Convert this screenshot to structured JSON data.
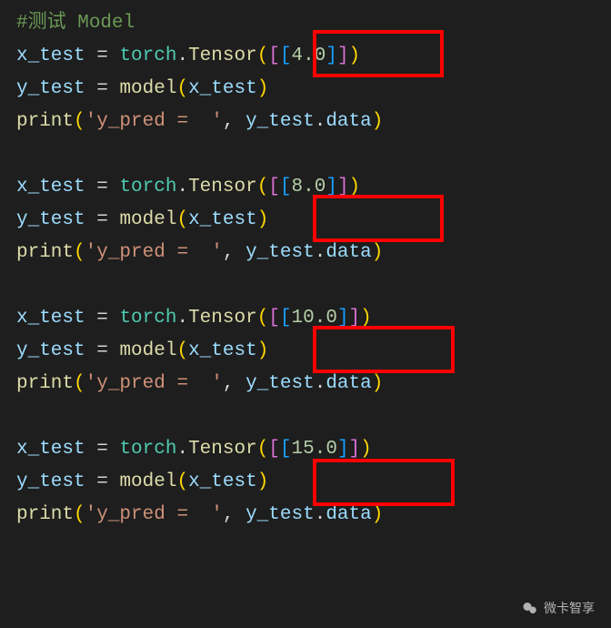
{
  "comment_hash": "#",
  "comment_cn": "测试",
  "comment_model": " Model",
  "blocks": [
    {
      "xvar": "x_test",
      "assign": " = ",
      "torch": "torch",
      "dot": ".",
      "tensor": "Tensor",
      "lp1": "(",
      "lb1": "[",
      "lb2": "[",
      "val": "4.0",
      "rb2": "]",
      "rb1": "]",
      "rp1": ")",
      "yvar": "y_test",
      "assign2": " = ",
      "model": "model",
      "lp2": "(",
      "arg": "x_test",
      "rp2": ")",
      "print": "print",
      "lp3": "(",
      "str": "'y_pred =  '",
      "comma": ", ",
      "yref": "y_test",
      "dot2": ".",
      "data": "data",
      "rp3": ")"
    },
    {
      "xvar": "x_test",
      "assign": " = ",
      "torch": "torch",
      "dot": ".",
      "tensor": "Tensor",
      "lp1": "(",
      "lb1": "[",
      "lb2": "[",
      "val": "8.0",
      "rb2": "]",
      "rb1": "]",
      "rp1": ")",
      "yvar": "y_test",
      "assign2": " = ",
      "model": "model",
      "lp2": "(",
      "arg": "x_test",
      "rp2": ")",
      "print": "print",
      "lp3": "(",
      "str": "'y_pred =  '",
      "comma": ", ",
      "yref": "y_test",
      "dot2": ".",
      "data": "data",
      "rp3": ")"
    },
    {
      "xvar": "x_test",
      "assign": " = ",
      "torch": "torch",
      "dot": ".",
      "tensor": "Tensor",
      "lp1": "(",
      "lb1": "[",
      "lb2": "[",
      "val": "10.0",
      "rb2": "]",
      "rb1": "]",
      "rp1": ")",
      "yvar": "y_test",
      "assign2": " = ",
      "model": "model",
      "lp2": "(",
      "arg": "x_test",
      "rp2": ")",
      "print": "print",
      "lp3": "(",
      "str": "'y_pred =  '",
      "comma": ", ",
      "yref": "y_test",
      "dot2": ".",
      "data": "data",
      "rp3": ")"
    },
    {
      "xvar": "x_test",
      "assign": " = ",
      "torch": "torch",
      "dot": ".",
      "tensor": "Tensor",
      "lp1": "(",
      "lb1": "[",
      "lb2": "[",
      "val": "15.0",
      "rb2": "]",
      "rb1": "]",
      "rp1": ")",
      "yvar": "y_test",
      "assign2": " = ",
      "model": "model",
      "lp2": "(",
      "arg": "x_test",
      "rp2": ")",
      "print": "print",
      "lp3": "(",
      "str": "'y_pred =  '",
      "comma": ", ",
      "yref": "y_test",
      "dot2": ".",
      "data": "data",
      "rp3": ")"
    }
  ],
  "watermark": "微卡智享"
}
